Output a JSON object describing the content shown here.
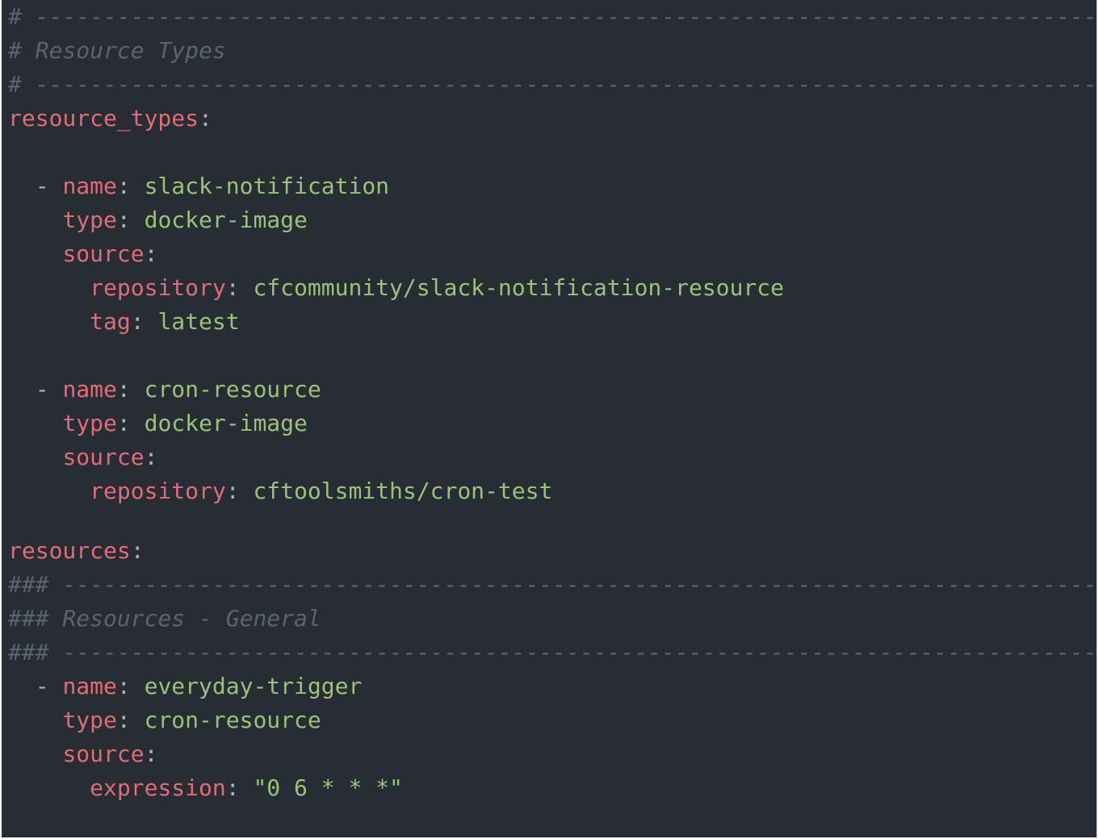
{
  "colors": {
    "background": "#282c34",
    "key": "#e06c75",
    "string": "#98c379",
    "comment": "#5c6370",
    "punctuation": "#abb2bf"
  },
  "editor": {
    "comment_rule": "# ----------------------------------------------------------------------------------------------------",
    "section_comment": "# Resource Types",
    "resource_types_key": "resource_types",
    "resource_types": [
      {
        "name_key": "name",
        "name": "slack-notification",
        "type_key": "type",
        "type": "docker-image",
        "source_key": "source",
        "repository_key": "repository",
        "repository": "cfcommunity/slack-notification-resource",
        "tag_key": "tag",
        "tag": "latest"
      },
      {
        "name_key": "name",
        "name": "cron-resource",
        "type_key": "type",
        "type": "docker-image",
        "source_key": "source",
        "repository_key": "repository",
        "repository": "cftoolsmiths/cron-test"
      }
    ],
    "resources_key": "resources",
    "general_rule": "### --------------------------------------------------------------------------------------------------",
    "general_comment": "### Resources - General",
    "resources": [
      {
        "name_key": "name",
        "name": "everyday-trigger",
        "type_key": "type",
        "type": "cron-resource",
        "source_key": "source",
        "expression_key": "expression",
        "expression": "\"0 6 * * *\""
      }
    ]
  }
}
